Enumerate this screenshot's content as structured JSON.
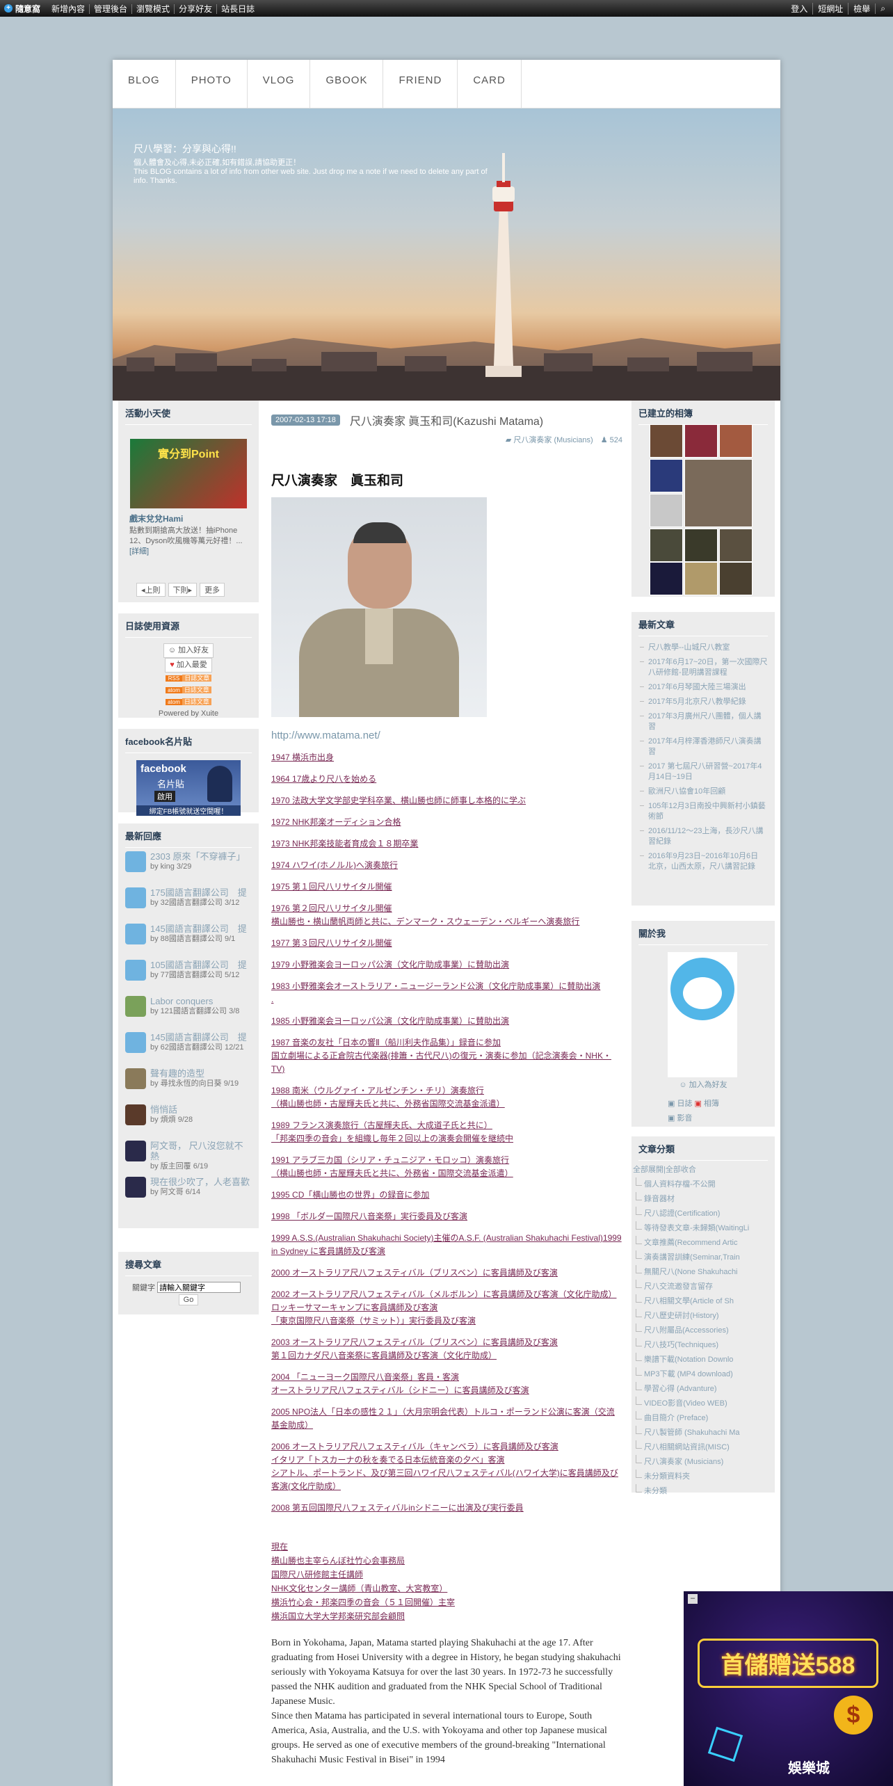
{
  "topbar": {
    "brand": "隨意窩",
    "links": [
      "新增內容",
      "管理後台",
      "瀏覽模式",
      "分享好友",
      "站長日誌"
    ],
    "right": [
      "登入",
      "短網址",
      "檢舉"
    ]
  },
  "nav": [
    "BLOG",
    "PHOTO",
    "VLOG",
    "GBOOK",
    "FRIEND",
    "CARD"
  ],
  "banner": {
    "title": "尺八學習：分享與心得!!",
    "lines": [
      "個人體會及心得,未必正確,如有錯誤,請協助更正！",
      "This BLOG contains a lot of info from other web site. Just drop me a note if we need to delete any part of info. Thanks."
    ]
  },
  "left": {
    "activity": {
      "title": "活動小天使",
      "ad_banner": "實分到Point",
      "link": "戲末兌兌Hami",
      "desc": "點數到期搶高大放送！抽iPhone 12、Dyson吹風機等萬元好禮！...",
      "more": "[詳細]",
      "prev": "◂上則",
      "next": "下則▸",
      "extra": "更多"
    },
    "resources": {
      "title": "日誌使用資源",
      "add_friend": "加入好友",
      "add_fav": "加入最愛",
      "feeds": [
        "RSS",
        "atom",
        "atom"
      ],
      "feed_label": "日誌文章",
      "powered": "Powered by Xuite"
    },
    "facebook": {
      "title": "facebook名片貼",
      "card_title": "facebook",
      "card_sub": "名片貼",
      "enable": "啟用",
      "card_foot": "綁定FB帳號就送空間喔！"
    },
    "replies": {
      "title": "最新回應",
      "items": [
        {
          "title": "2303 原來「不穿褲子」",
          "meta": "by king 3/29"
        },
        {
          "title": "175國語言翻譯公司　提",
          "meta": "by 32國語言翻譯公司 3/12"
        },
        {
          "title": "145國語言翻譯公司　提",
          "meta": "by 88國語言翻譯公司 9/1"
        },
        {
          "title": "105國語言翻譯公司　提",
          "meta": "by 77國語言翻譯公司 5/12"
        },
        {
          "title": "Labor conquers",
          "meta": "by 121國語言翻譯公司 3/8"
        },
        {
          "title": "145國語言翻譯公司　提",
          "meta": "by 62國語言翻譯公司 12/21"
        },
        {
          "title": "聲有趣的造型",
          "meta": "by 尋找永恆的向日葵 9/19"
        },
        {
          "title": "悄悄話",
          "meta": "by 煩煩 9/28"
        },
        {
          "title": "阿文哥， 尺八沒您就不熱",
          "meta": "by 版主回覆 6/19"
        },
        {
          "title": "現在很少吹了，人老喜歡",
          "meta": "by 阿文哥 6/14"
        }
      ]
    },
    "search": {
      "title": "搜尋文章",
      "label": "關鍵字",
      "placeholder": "請輸入關鍵字",
      "go": "Go"
    }
  },
  "post": {
    "date": "2007-02-13 17:18",
    "title": "尺八演奏家 眞玉和司(Kazushi Matama)",
    "category": "尺八演奏家 (Musicians)",
    "views": "524",
    "heading": "尺八演奏家　眞玉和司",
    "url": "http://www.matama.net/",
    "timeline": [
      [
        "1947  横浜市出身"
      ],
      [
        "1964  17歳より尺八を始める"
      ],
      [
        "1970  法政大学文学部史学科卒業、横山勝也師に師事し本格的に学ぶ"
      ],
      [
        "1972  NHK邦楽オーディション合格"
      ],
      [
        "1973  NHK邦楽技能者育成会１８期卒業"
      ],
      [
        "1974  ハワイ(ホノルル)へ演奏旅行"
      ],
      [
        "1975  第１回尺八リサイタル開催"
      ],
      [
        "1976  第２回尺八リサイタル開催",
        "横山勝也・横山蘭帆両師と共に、デンマーク・スウェーデン・ベルギーへ演奏旅行"
      ],
      [
        "1977  第３回尺八リサイタル開催"
      ],
      [
        "1979  小野雅楽会ヨーロッパ公演（文化庁助成事業）に賛助出演"
      ],
      [
        "1983  小野雅楽会オーストラリア・ニュージーランド公演（文化庁助成事業）に賛助出演",
        "."
      ],
      [
        "1985  小野雅楽会ヨーロッパ公演（文化庁助成事業）に賛助出演"
      ],
      [
        "1987  音楽の友社「日本の響Ⅱ（船川利夫作品集）」録音に参加",
        "国立劇場による正倉院古代楽器(排簫・古代尺八)の復元・演奏に参加（記念演奏会・NHK・TV)"
      ],
      [
        "1988  南米（ウルグァイ・アルゼンチン・チリ）演奏旅行",
        "（横山勝也師・古屋輝夫氏と共に、外務省国際交流基金派遣）"
      ],
      [
        "1989  フランス演奏旅行（古屋輝夫氏、大成道子氏と共に）",
        "「邦楽四季の音会」を組織し毎年２回以上の演奏会開催を継続中"
      ],
      [
        "1991  アラブ三カ国（シリア・チュニジア・モロッコ）演奏旅行",
        "（横山勝也師・古屋輝夫氏と共に、外務省・国際交流基金派遣）"
      ],
      [
        "1995  CD「横山勝也の世界」の録音に参加"
      ],
      [
        "1998  「ボルダー国際尺八音楽祭」実行委員及び客演"
      ],
      [
        "1999  A.S.S.(Australian Shakuhachi Society)主催のA.S.F. (Australian Shakuhachi Festival)1999 in Sydney に客員講師及び客演"
      ],
      [
        "2000  オーストラリア尺八フェスティバル（ブリスベン）に客員講師及び客演"
      ],
      [
        "2002  オーストラリア尺八フェスティバル（メルボルン）に客員講師及び客演（文化庁助成）",
        "ロッキーサマーキャンプに客員講師及び客演",
        "「東京国際尺八音楽祭（サミット）」実行委員及び客演"
      ],
      [
        "2003  オーストラリア尺八フェスティバル（ブリスベン）に客員講師及び客演",
        "第１回カナダ尺八音楽祭に客員講師及び客演（文化庁助成）"
      ],
      [
        "2004  「ニューヨーク国際尺八音楽祭」客員・客演",
        "オーストラリア尺八フェスティバル（シドニー）に客員講師及び客演"
      ],
      [
        "2005  NPO法人「日本の感性２１」（大月宗明会代表）トルコ・ポーランド公演に客演（交流基金助成）"
      ],
      [
        "2006  オーストラリア尺八フェスティバル（キャンベラ）に客員講師及び客演",
        "イタリア「トスカーナの秋を奏でる日本伝統音楽の夕べ」客演",
        "シアトル、ポートランド、及び第三回ハワイ尺八フェスティバル(ハワイ大学)に客員講師及び客演(文化庁助成）"
      ],
      [
        "2008  第五回国際尺八フェスティバルinシドニーに出演及び実行委員"
      ]
    ],
    "current": [
      "現在",
      "横山勝也主宰らんぼ社竹心会事務局",
      "国際尺八研修館主任講師",
      "NHK文化センター講師（青山教室、大宮教室）",
      "横浜竹心会・邦楽四季の音会（５１回開催）主宰",
      "横浜国立大学大学邦楽研究部会顧問"
    ],
    "bio": "Born in Yokohama, Japan, Matama started playing Shakuhachi at the age 17. After graduating from Hosei University with a degree in History, he began studying shakuhachi seriously with Yokoyama Katsuya for over the last 30 years. In 1972-73 he successfully passed the NHK audition and graduated from the NHK Special School of Traditional Japanese Music.",
    "bio2": "Since then Matama has participated in several international tours to Europe, South America, Asia, Australia, and the U.S. with Yokoyama and other top Japanese musical groups. He served as one of executive members of the ground-breaking \"International Shakuhachi Music Festival in Bisei\" in 1994"
  },
  "right": {
    "albums": {
      "title": "已建立的相簿"
    },
    "latest": {
      "title": "最新文章",
      "items": [
        "尺八教學--山城尺八教室",
        "2017年6月17~20日，第一次國際尺八研修館-昆明講習課程",
        "2017年6月琴國大陸三場演出",
        "2017年5月北京尺八教學紀錄",
        "2017年3月廣州尺八團體，個人講習",
        "2017年4月梓澤香港師尺八演奏講習",
        "2017 第七屆尺八研習營~2017年4月14日~19日",
        "歐洲尺八協會10年回顧",
        "105年12月3日南投中興新村小鎮藝術節",
        "2016/11/12～23上海，長沙尺八講習紀錄",
        "2016年9月23日~2016年10月6日 北京，山西太原，尺八講習記錄"
      ]
    },
    "about": {
      "title": "關於我",
      "add_friend": "加入為好友",
      "links": [
        "日誌",
        "相簿",
        "影音"
      ]
    },
    "cats": {
      "title": "文章分類",
      "expand": "全部展開|全部收合",
      "items": [
        "個人資料存檔-不公開",
        "錄音器材",
        "尺八認證(Certification)",
        "等待發表文章-未歸類(WaitingLi",
        "文章推薦(Recommend Artic",
        "演奏講習訓練(Seminar,Train",
        "無關尺八(None Shakuhachi",
        "尺八交流邀發言留存",
        "尺八相關文學(Article of Sh",
        "尺八歷史研討(History)",
        "尺八附屬品(Accessories)",
        "尺八技巧(Techniques)",
        "樂譜下載(Notation Downlo",
        "MP3下載 (MP4 download)",
        "學習心得 (Advanture)",
        "VIDEO影音(Video WEB)",
        "曲目簡介 (Preface)",
        "尺八製管師 (Shakuhachi Ma",
        "尺八相關網站資訊(MISC)",
        "尺八演奏家 (Musicians)",
        "未分類資料夾",
        "未分類"
      ]
    }
  },
  "ad": {
    "text": "首儲贈送588",
    "brand": "娛樂城",
    "badge": "$"
  },
  "colors": {
    "accent": "#4a6f88",
    "link": "#7a2a55",
    "panel": "#ececec"
  }
}
